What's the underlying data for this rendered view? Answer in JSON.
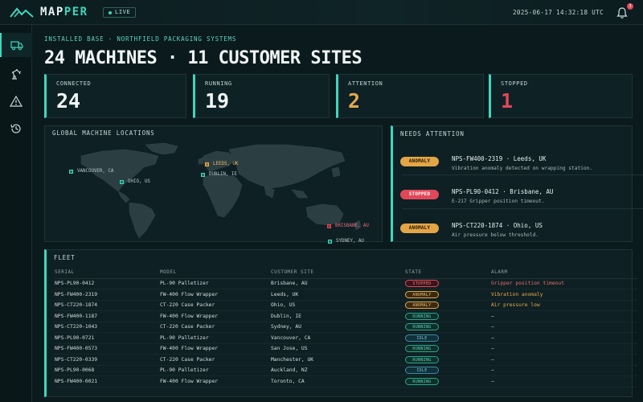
{
  "app": {
    "name_main": "MAP",
    "name_accent": "PER",
    "live": "LIVE",
    "clock": "2025-06-17 14:32:18 UTC",
    "bell_count": "3"
  },
  "sidebar": [
    {
      "icon": "truck-icon"
    },
    {
      "icon": "robot-arm-icon"
    },
    {
      "icon": "warning-icon"
    },
    {
      "icon": "history-icon"
    }
  ],
  "header": {
    "eyebrow": "INSTALLED BASE · NORTHFIELD PACKAGING SYSTEMS",
    "title": "24 MACHINES · 11 CUSTOMER SITES"
  },
  "stats": [
    {
      "label": "CONNECTED",
      "value": "24",
      "color": "#f0f6f6"
    },
    {
      "label": "RUNNING",
      "value": "19",
      "color": "#f0f6f6"
    },
    {
      "label": "ATTENTION",
      "value": "2",
      "color": "#e6a852"
    },
    {
      "label": "STOPPED",
      "value": "1",
      "color": "#e0485a"
    }
  ],
  "map": {
    "title": "GLOBAL MACHINE LOCATIONS",
    "pins": [
      {
        "label": "VANCOUVER, CA",
        "status": "ok"
      },
      {
        "label": "OHIO, US",
        "status": "ok"
      },
      {
        "label": "LEEDS, UK",
        "status": "warn"
      },
      {
        "label": "DUBLIN, IE",
        "status": "ok"
      },
      {
        "label": "BRISBANE, AU",
        "status": "err"
      },
      {
        "label": "SYDNEY, AU",
        "status": "ok"
      }
    ]
  },
  "attention": {
    "title": "NEEDS ATTENTION",
    "items": [
      {
        "badge": "ANOMALY",
        "kind": "anomaly",
        "title": "NPS-FW400-2319  ·  Leeds, UK",
        "desc": "Vibration anomaly detected on wrapping station."
      },
      {
        "badge": "STOPPED",
        "kind": "stopped",
        "title": "NPS-PL90-0412  ·  Brisbane, AU",
        "desc": "E-217 Gripper position timeout."
      },
      {
        "badge": "ANOMALY",
        "kind": "anomaly",
        "title": "NPS-CT220-1874  ·  Ohio, US",
        "desc": "Air pressure below threshold."
      }
    ]
  },
  "fleet": {
    "title": "FLEET",
    "columns": [
      "SERIAL",
      "MODEL",
      "CUSTOMER SITE",
      "STATE",
      "ALARM"
    ],
    "rows": [
      {
        "serial": "NPS-PL90-0412",
        "model": "PL-90 Palletizer",
        "site": "Brisbane, AU",
        "state": "STOPPED",
        "alarm": "Gripper position timeout"
      },
      {
        "serial": "NPS-FW400-2319",
        "model": "FW-400 Flow Wrapper",
        "site": "Leeds, UK",
        "state": "ANOMALY",
        "alarm": "Vibration anomaly"
      },
      {
        "serial": "NPS-CT220-1874",
        "model": "CT-220 Case Packer",
        "site": "Ohio, US",
        "state": "ANOMALY",
        "alarm": "Air pressure low"
      },
      {
        "serial": "NPS-FW400-1187",
        "model": "FW-400 Flow Wrapper",
        "site": "Dublin, IE",
        "state": "RUNNING",
        "alarm": "—"
      },
      {
        "serial": "NPS-CT220-1043",
        "model": "CT-220 Case Packer",
        "site": "Sydney, AU",
        "state": "RUNNING",
        "alarm": "—"
      },
      {
        "serial": "NPS-PL90-0721",
        "model": "PL-90 Palletizer",
        "site": "Vancouver, CA",
        "state": "IDLE",
        "alarm": "—"
      },
      {
        "serial": "NPS-FW400-0573",
        "model": "FW-400 Flow Wrapper",
        "site": "San Jose, US",
        "state": "RUNNING",
        "alarm": "—"
      },
      {
        "serial": "NPS-CT220-0339",
        "model": "CT-220 Case Packer",
        "site": "Manchester, UK",
        "state": "RUNNING",
        "alarm": "—"
      },
      {
        "serial": "NPS-PL90-0068",
        "model": "PL-90 Palletizer",
        "site": "Auckland, NZ",
        "state": "IDLE",
        "alarm": "—"
      },
      {
        "serial": "NPS-FW400-0021",
        "model": "FW-400 Flow Wrapper",
        "site": "Toronto, CA",
        "state": "RUNNING",
        "alarm": "—"
      }
    ]
  }
}
